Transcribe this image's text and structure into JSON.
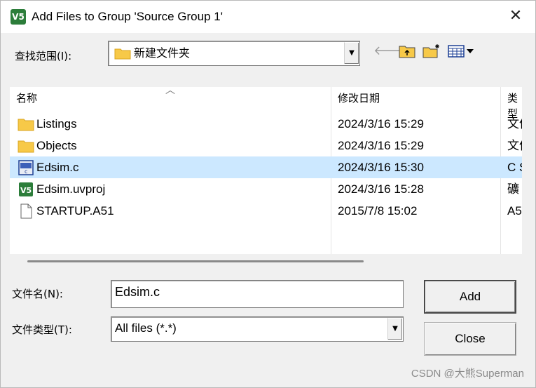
{
  "window": {
    "title": "Add Files to Group 'Source Group 1'",
    "app_icon_text": "V5"
  },
  "lookin": {
    "label": "查找范围(I):",
    "value": "新建文件夹"
  },
  "list": {
    "columns": [
      "名称",
      "修改日期",
      "类型"
    ],
    "rows": [
      {
        "name": "Listings",
        "date": "2024/3/16 15:29",
        "type": "文件",
        "icon": "folder-icon",
        "selected": false
      },
      {
        "name": "Objects",
        "date": "2024/3/16 15:29",
        "type": "文件",
        "icon": "folder-icon",
        "selected": false
      },
      {
        "name": "Edsim.c",
        "date": "2024/3/16 15:30",
        "type": "C S",
        "icon": "c-source-file-icon",
        "selected": true
      },
      {
        "name": "Edsim.uvproj",
        "date": "2024/3/16 15:28",
        "type": "礦",
        "icon": "uvision-project-icon",
        "selected": false
      },
      {
        "name": "STARTUP.A51",
        "date": "2015/7/8 15:02",
        "type": "A5",
        "icon": "blank-file-icon",
        "selected": false
      }
    ]
  },
  "filename": {
    "label": "文件名(N):",
    "value": "Edsim.c"
  },
  "filetype": {
    "label": "文件类型(T):",
    "value": "All files (*.*)"
  },
  "buttons": {
    "add": "Add",
    "close": "Close"
  },
  "watermark": "CSDN @大熊Superman",
  "colors": {
    "selection": "#cce8ff",
    "folder": "#f7c948",
    "keil_green": "#2c7d3a"
  }
}
